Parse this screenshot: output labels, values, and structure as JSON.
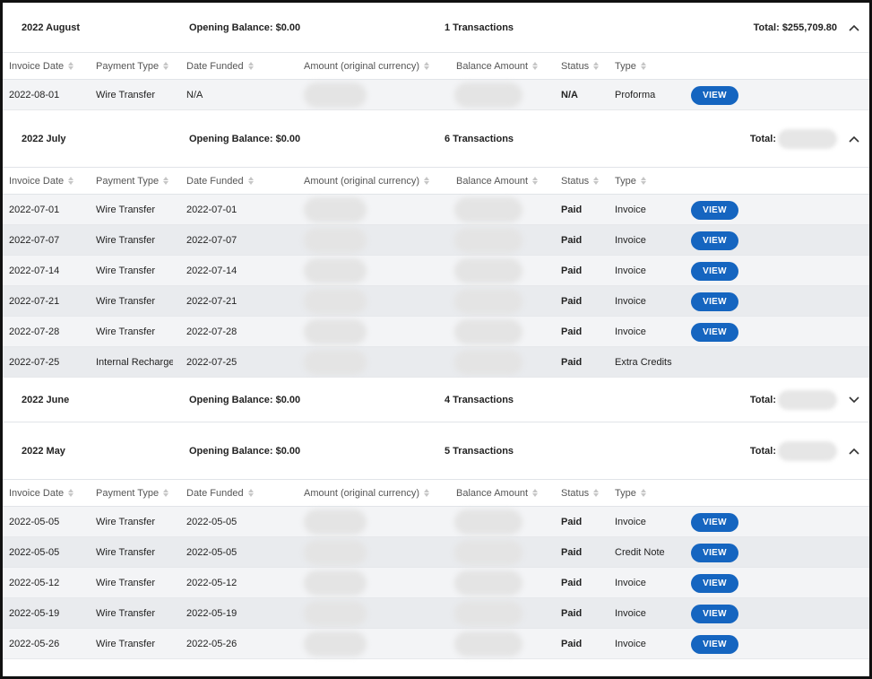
{
  "columns": [
    "Invoice Date",
    "Payment Type",
    "Date Funded",
    "Amount (original currency)",
    "Balance Amount",
    "Status",
    "Type"
  ],
  "view_label": "VIEW",
  "groups": [
    {
      "title": "2022 August",
      "opening": "Opening Balance: $0.00",
      "transactions": "1 Transactions",
      "total_label": "Total: $255,709.80",
      "total_blurred": false,
      "expanded": true,
      "rows": [
        {
          "invoice_date": "2022-08-01",
          "payment_type": "Wire Transfer",
          "date_funded": "N/A",
          "status": "N/A",
          "type": "Proforma",
          "view": true
        }
      ]
    },
    {
      "title": "2022 July",
      "opening": "Opening Balance: $0.00",
      "transactions": "6 Transactions",
      "total_label": "Total:",
      "total_blurred": true,
      "expanded": true,
      "rows": [
        {
          "invoice_date": "2022-07-01",
          "payment_type": "Wire Transfer",
          "date_funded": "2022-07-01",
          "status": "Paid",
          "type": "Invoice",
          "view": true
        },
        {
          "invoice_date": "2022-07-07",
          "payment_type": "Wire Transfer",
          "date_funded": "2022-07-07",
          "status": "Paid",
          "type": "Invoice",
          "view": true
        },
        {
          "invoice_date": "2022-07-14",
          "payment_type": "Wire Transfer",
          "date_funded": "2022-07-14",
          "status": "Paid",
          "type": "Invoice",
          "view": true
        },
        {
          "invoice_date": "2022-07-21",
          "payment_type": "Wire Transfer",
          "date_funded": "2022-07-21",
          "status": "Paid",
          "type": "Invoice",
          "view": true
        },
        {
          "invoice_date": "2022-07-28",
          "payment_type": "Wire Transfer",
          "date_funded": "2022-07-28",
          "status": "Paid",
          "type": "Invoice",
          "view": true
        },
        {
          "invoice_date": "2022-07-25",
          "payment_type": "Internal Recharge",
          "date_funded": "2022-07-25",
          "status": "Paid",
          "type": "Extra Credits",
          "view": false
        }
      ]
    },
    {
      "title": "2022 June",
      "opening": "Opening Balance: $0.00",
      "transactions": "4 Transactions",
      "total_label": "Total:",
      "total_blurred": true,
      "expanded": false,
      "rows": []
    },
    {
      "title": "2022 May",
      "opening": "Opening Balance: $0.00",
      "transactions": "5 Transactions",
      "total_label": "Total:",
      "total_blurred": true,
      "expanded": true,
      "rows": [
        {
          "invoice_date": "2022-05-05",
          "payment_type": "Wire Transfer",
          "date_funded": "2022-05-05",
          "status": "Paid",
          "type": "Invoice",
          "view": true
        },
        {
          "invoice_date": "2022-05-05",
          "payment_type": "Wire Transfer",
          "date_funded": "2022-05-05",
          "status": "Paid",
          "type": "Credit Note",
          "view": true
        },
        {
          "invoice_date": "2022-05-12",
          "payment_type": "Wire Transfer",
          "date_funded": "2022-05-12",
          "status": "Paid",
          "type": "Invoice",
          "view": true
        },
        {
          "invoice_date": "2022-05-19",
          "payment_type": "Wire Transfer",
          "date_funded": "2022-05-19",
          "status": "Paid",
          "type": "Invoice",
          "view": true
        },
        {
          "invoice_date": "2022-05-26",
          "payment_type": "Wire Transfer",
          "date_funded": "2022-05-26",
          "status": "Paid",
          "type": "Invoice",
          "view": true
        }
      ]
    }
  ],
  "colors": {
    "view_button": "#1565c0",
    "row_alt": "#f3f4f6"
  }
}
